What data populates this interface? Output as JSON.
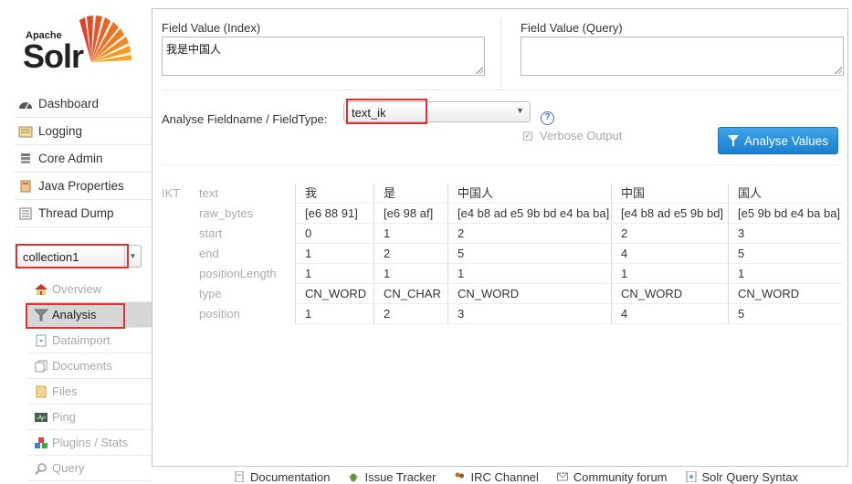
{
  "logo": {
    "apache": "Apache",
    "solr": "Solr"
  },
  "sidebar": {
    "items": [
      {
        "label": "Dashboard",
        "icon": "dashboard-icon"
      },
      {
        "label": "Logging",
        "icon": "logging-icon"
      },
      {
        "label": "Core Admin",
        "icon": "core-admin-icon"
      },
      {
        "label": "Java Properties",
        "icon": "java-properties-icon"
      },
      {
        "label": "Thread Dump",
        "icon": "thread-dump-icon"
      }
    ],
    "core_selector": {
      "value": "collection1"
    },
    "core_items": [
      {
        "label": "Overview",
        "icon": "overview-icon"
      },
      {
        "label": "Analysis",
        "icon": "analysis-icon",
        "active": true
      },
      {
        "label": "Dataimport",
        "icon": "dataimport-icon"
      },
      {
        "label": "Documents",
        "icon": "documents-icon"
      },
      {
        "label": "Files",
        "icon": "files-icon"
      },
      {
        "label": "Ping",
        "icon": "ping-icon"
      },
      {
        "label": "Plugins / Stats",
        "icon": "plugins-icon"
      },
      {
        "label": "Query",
        "icon": "query-icon"
      }
    ]
  },
  "form": {
    "index_label": "Field Value (Index)",
    "index_value": "我是中国人",
    "query_label": "Field Value (Query)",
    "query_value": "",
    "fieldtype_label": "Analyse Fieldname / FieldType:",
    "fieldtype_value": "text_ik",
    "help": "?",
    "verbose_label": "Verbose Output",
    "verbose_checked": true,
    "analyse_button": "Analyse Values"
  },
  "analysis": {
    "tokenizer": "IKT",
    "attributes": [
      "text",
      "raw_bytes",
      "start",
      "end",
      "positionLength",
      "type",
      "position"
    ],
    "tokens": [
      {
        "text": "我",
        "raw_bytes": "[e6 88 91]",
        "start": "0",
        "end": "1",
        "positionLength": "1",
        "type": "CN_WORD",
        "position": "1"
      },
      {
        "text": "是",
        "raw_bytes": "[e6 98 af]",
        "start": "1",
        "end": "2",
        "positionLength": "1",
        "type": "CN_CHAR",
        "position": "2"
      },
      {
        "text": "中国人",
        "raw_bytes": "[e4 b8 ad e5 9b bd e4 ba ba]",
        "start": "2",
        "end": "5",
        "positionLength": "1",
        "type": "CN_WORD",
        "position": "3"
      },
      {
        "text": "中国",
        "raw_bytes": "[e4 b8 ad e5 9b bd]",
        "start": "2",
        "end": "4",
        "positionLength": "1",
        "type": "CN_WORD",
        "position": "4"
      },
      {
        "text": "国人",
        "raw_bytes": "[e5 9b bd e4 ba ba]",
        "start": "3",
        "end": "5",
        "positionLength": "1",
        "type": "CN_WORD",
        "position": "5"
      }
    ]
  },
  "footer": {
    "links": [
      {
        "label": "Documentation",
        "icon": "documentation-icon"
      },
      {
        "label": "Issue Tracker",
        "icon": "bug-icon"
      },
      {
        "label": "IRC Channel",
        "icon": "irc-icon"
      },
      {
        "label": "Community forum",
        "icon": "mail-icon"
      },
      {
        "label": "Solr Query Syntax",
        "icon": "syntax-icon"
      }
    ]
  },
  "colors": {
    "accent": "#1a7fd0",
    "highlight": "#e0302b",
    "brand_orange": "#f06a24"
  }
}
